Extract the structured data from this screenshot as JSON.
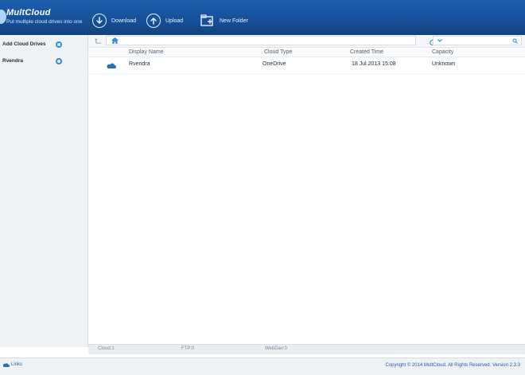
{
  "header": {
    "brand": "MultCloud",
    "tagline": "Put multiple cloud drives into one",
    "toolbar": [
      {
        "label": "Download",
        "icon": "download-icon"
      },
      {
        "label": "Upload",
        "icon": "upload-icon"
      },
      {
        "label": "New Folder",
        "icon": "new-folder-icon"
      }
    ]
  },
  "sidebar": {
    "items": [
      {
        "label": "Add Cloud Drives",
        "icon": "add-icon"
      },
      {
        "label": "Rvendra",
        "icon": "settings-icon"
      }
    ]
  },
  "main": {
    "table": {
      "columns": [
        "Display Name",
        "Cloud Type",
        "Created Time",
        "Capacity"
      ],
      "rows": [
        {
          "display_name": "Rvendra",
          "cloud_type": "OneDrive",
          "created_time": "18 Jul 2013 15:08",
          "capacity": "Unknown"
        }
      ]
    }
  },
  "status": {
    "items": [
      "Cloud:1",
      "FTP:0",
      "WebDav:0"
    ]
  },
  "footer": {
    "links": "Links",
    "copyright": "Copyright © 2014 MultCloud. All Rights Reserved. Version 2.3.3"
  },
  "colors": {
    "header_blue": "#174f97",
    "accent_blue": "#2f8ddc"
  }
}
